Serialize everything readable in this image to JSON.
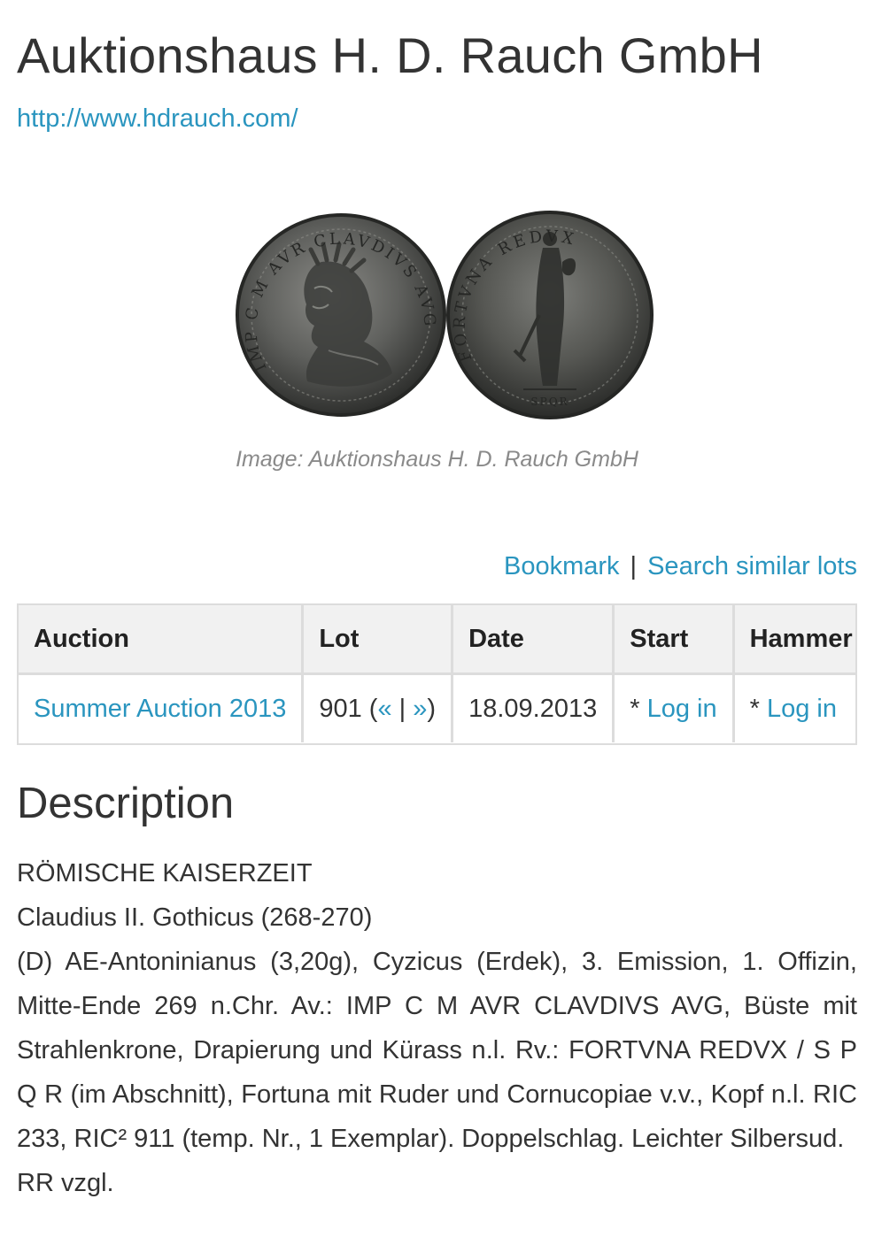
{
  "header": {
    "title": "Auktionshaus H. D. Rauch GmbH",
    "website": "http://www.hdrauch.com/"
  },
  "image": {
    "caption": "Image: Auktionshaus H. D. Rauch GmbH"
  },
  "actions": {
    "bookmark": "Bookmark",
    "separator": "|",
    "search_similar": "Search similar lots"
  },
  "table": {
    "headers": {
      "auction": "Auction",
      "lot": "Lot",
      "date": "Date",
      "start": "Start",
      "hammer": "Hammer"
    },
    "row": {
      "auction": "Summer Auction 2013",
      "lot_number": "901",
      "lot_open": "(",
      "prev": "«",
      "lot_sep": "|",
      "next": "»",
      "lot_close": ")",
      "date": "18.09.2013",
      "start_prefix": "* ",
      "start_link": "Log in",
      "hammer_prefix": "* ",
      "hammer_link": "Log in"
    }
  },
  "description": {
    "heading": "Description",
    "line1": "RÖMISCHE KAISERZEIT",
    "line2": "Claudius II. Gothicus (268-270)",
    "body": "(D) AE-Antoninianus (3,20g), Cyzicus (Erdek), 3. Emission, 1. Offizin, Mitte-Ende 269 n.Chr. Av.: IMP C M AVR CLAVDIVS AVG, Büste mit Strahlenkrone, Drapierung und Kürass n.l. Rv.: FORTVNA REDVX / S P Q R (im Abschnitt), Fortuna mit Ruder und Cornucopiae v.v., Kopf n.l. RIC 233, RIC² 911 (temp. Nr., 1 Exemplar). Doppelschlag. Le­ichter Silbersud.",
    "rarity": "RR vzgl."
  },
  "colors": {
    "link": "#2a95bf",
    "text": "#333333",
    "caption": "#8a8a8a",
    "table_header_bg": "#f1f1f1",
    "table_border": "#dcdcdc"
  }
}
